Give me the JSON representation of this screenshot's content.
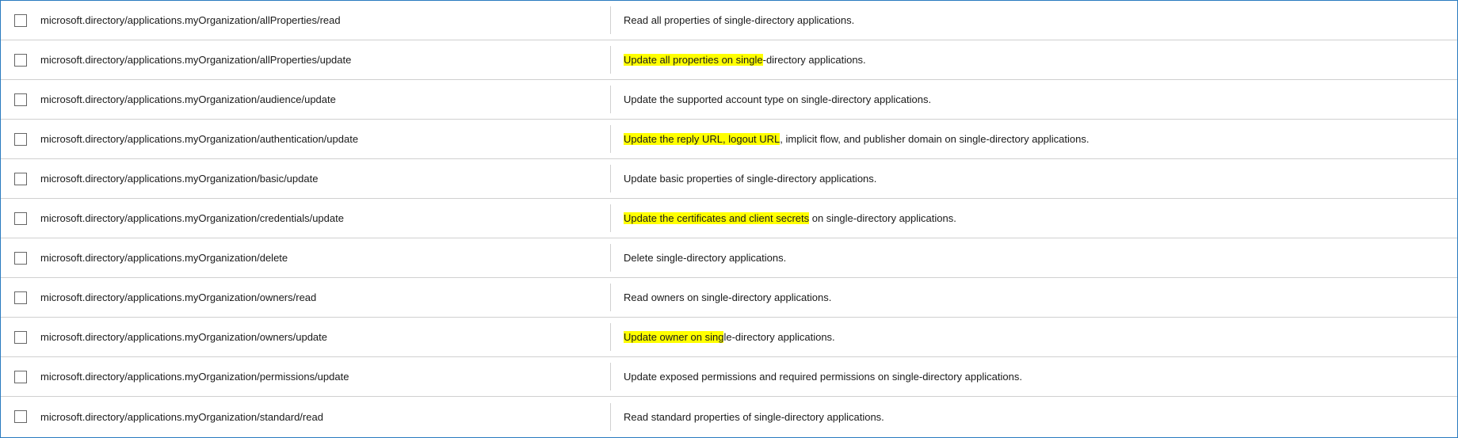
{
  "rows": [
    {
      "id": "row-1",
      "permission": "microsoft.directory/applications.myOrganization/allProperties/read",
      "description": [
        {
          "text": "Read all properties of single-directory applications.",
          "highlight": false
        }
      ],
      "checked": false
    },
    {
      "id": "row-2",
      "permission": "microsoft.directory/applications.myOrganization/allProperties/update",
      "description": [
        {
          "text": "Update all properties on single",
          "highlight": true
        },
        {
          "text": "-directory applications.",
          "highlight": false
        }
      ],
      "checked": false
    },
    {
      "id": "row-3",
      "permission": "microsoft.directory/applications.myOrganization/audience/update",
      "description": [
        {
          "text": "Update the supported account type on single-directory applications.",
          "highlight": false
        }
      ],
      "checked": false
    },
    {
      "id": "row-4",
      "permission": "microsoft.directory/applications.myOrganization/authentication/update",
      "description": [
        {
          "text": "Update the reply URL, logout URL",
          "highlight": true
        },
        {
          "text": ", implicit flow, and publisher domain on single-directory applications.",
          "highlight": false
        }
      ],
      "checked": false
    },
    {
      "id": "row-5",
      "permission": "microsoft.directory/applications.myOrganization/basic/update",
      "description": [
        {
          "text": "Update basic properties of single-directory applications.",
          "highlight": false
        }
      ],
      "checked": false
    },
    {
      "id": "row-6",
      "permission": "microsoft.directory/applications.myOrganization/credentials/update",
      "description": [
        {
          "text": "Update the certificates and client secrets",
          "highlight": true
        },
        {
          "text": " on single-directory applications.",
          "highlight": false
        }
      ],
      "checked": false
    },
    {
      "id": "row-7",
      "permission": "microsoft.directory/applications.myOrganization/delete",
      "description": [
        {
          "text": "Delete single-directory applications.",
          "highlight": false
        }
      ],
      "checked": false
    },
    {
      "id": "row-8",
      "permission": "microsoft.directory/applications.myOrganization/owners/read",
      "description": [
        {
          "text": "Read owners on single-directory applications.",
          "highlight": false
        }
      ],
      "checked": false
    },
    {
      "id": "row-9",
      "permission": "microsoft.directory/applications.myOrganization/owners/update",
      "description": [
        {
          "text": "Update owner on sing",
          "highlight": true
        },
        {
          "text": "le-directory applications.",
          "highlight": false
        }
      ],
      "checked": false
    },
    {
      "id": "row-10",
      "permission": "microsoft.directory/applications.myOrganization/permissions/update",
      "description": [
        {
          "text": "Update exposed permissions and required permissions on single-directory applications.",
          "highlight": false
        }
      ],
      "checked": false
    },
    {
      "id": "row-11",
      "permission": "microsoft.directory/applications.myOrganization/standard/read",
      "description": [
        {
          "text": "Read standard properties of single-directory applications.",
          "highlight": false
        }
      ],
      "checked": false
    }
  ]
}
